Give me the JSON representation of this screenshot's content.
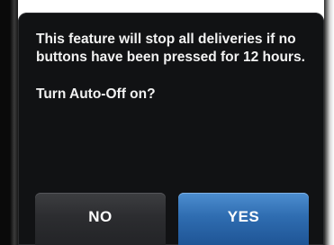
{
  "dialog": {
    "message": "This feature will stop all deliveries if no buttons have been pressed for 12 hours.",
    "question": "Turn Auto-Off on?"
  },
  "buttons": {
    "no_label": "NO",
    "yes_label": "YES"
  },
  "colors": {
    "screen_background": "#111214",
    "text": "#f2f2f2",
    "no_button": "#2c2d30",
    "yes_button": "#2f6db1"
  }
}
